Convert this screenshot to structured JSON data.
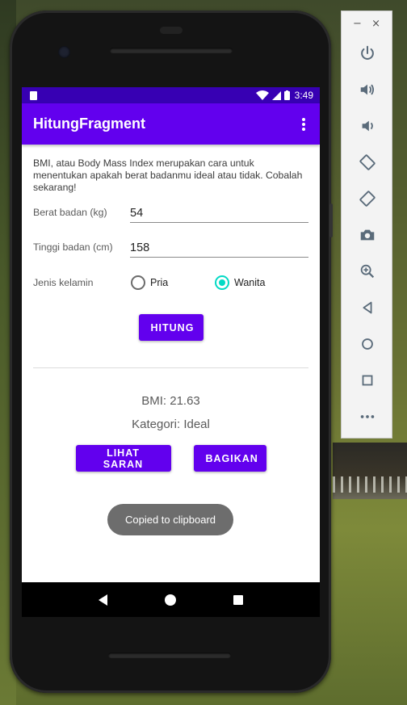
{
  "status_bar": {
    "time": "3:49"
  },
  "toolbar": {
    "title": "HitungFragment"
  },
  "content": {
    "description": "BMI, atau Body Mass Index merupakan cara untuk menentukan apakah berat badanmu ideal atau tidak. Cobalah sekarang!",
    "weight": {
      "label": "Berat badan (kg)",
      "value": "54"
    },
    "height": {
      "label": "Tinggi badan (cm)",
      "value": "158"
    },
    "gender": {
      "label": "Jenis kelamin",
      "options": [
        "Pria",
        "Wanita"
      ],
      "selected": "Wanita"
    },
    "calc_button": "HITUNG",
    "bmi_text": "BMI: 21.63",
    "category_text": "Kategori: Ideal",
    "advice_button": "LIHAT SARAN",
    "share_button": "BAGIKAN"
  },
  "toast": {
    "text": "Copied to clipboard"
  },
  "emulator_panel": {
    "minimize": "−",
    "close": "×",
    "tools": [
      "power-icon",
      "volume-up-icon",
      "volume-down-icon",
      "rotate-left-icon",
      "rotate-right-icon",
      "camera-icon",
      "zoom-icon",
      "back-icon",
      "home-icon",
      "overview-icon",
      "more-icon"
    ]
  },
  "colors": {
    "primary": "#6200ee",
    "primary_dark": "#3700b3",
    "accent": "#03dac5"
  }
}
